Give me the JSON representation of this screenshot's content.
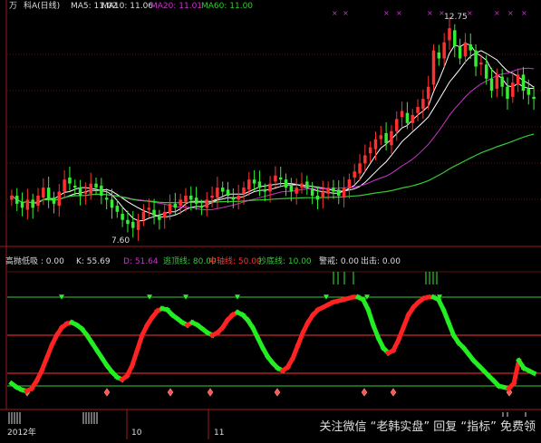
{
  "upper_header": {
    "title": "科A(日线)",
    "title_prefix": "万",
    "ma5": "MA5: 11.02",
    "ma10": "MA10: 11.06",
    "ma20": "MA20: 11.01",
    "ma60": "MA60: 11.00",
    "colors": {
      "ma5": "#ffffff",
      "ma10": "#ffffff",
      "ma20": "#cc33cc",
      "ma60": "#33cc33"
    }
  },
  "upper_annotations": {
    "high": "12.75",
    "low": "7.60"
  },
  "lower_header": {
    "name": "高抛低吸 : 0.00",
    "k": "K: 55.69",
    "d": "D: 51.64",
    "escape_top": "逃顶线: 80.00",
    "mid_axis": "中轴线: 50.00",
    "bottom_buy": "抄底线: 10.00",
    "alert": "警戒: 0.00",
    "strike": "出击: 0.00",
    "colors": {
      "name": "#dddddd",
      "k": "#dddddd",
      "d": "#cc33cc",
      "escape_top": "#33cc33",
      "mid_axis": "#ff3333",
      "bottom_buy": "#33cc33",
      "alert": "#dddddd",
      "strike": "#dddddd"
    }
  },
  "timeline": {
    "year_label": "2012年",
    "months": [
      "10",
      "11"
    ]
  },
  "watermark": "关注微信 “老韩实盘” 回复 “指标” 免费领",
  "chart_data": [
    {
      "type": "candlestick",
      "title": "科A(日线)",
      "annotations": [
        {
          "label": "12.75",
          "kind": "high"
        },
        {
          "label": "7.60",
          "kind": "low"
        }
      ],
      "close": [
        8.6,
        8.4,
        8.3,
        8.5,
        8.3,
        8.6,
        8.8,
        8.5,
        8.4,
        8.7,
        9.0,
        8.9,
        8.8,
        8.6,
        8.7,
        8.9,
        8.8,
        8.6,
        8.5,
        8.3,
        8.2,
        8.0,
        7.9,
        7.8,
        8.0,
        8.2,
        8.3,
        8.1,
        8.0,
        8.2,
        8.4,
        8.3,
        8.5,
        8.6,
        8.5,
        8.4,
        8.3,
        8.5,
        8.6,
        8.8,
        8.7,
        8.6,
        8.5,
        8.6,
        8.8,
        9.0,
        8.9,
        8.8,
        8.7,
        8.9,
        9.1,
        9.0,
        8.8,
        8.7,
        8.8,
        8.9,
        8.8,
        8.6,
        8.5,
        8.7,
        8.8,
        8.7,
        8.6,
        8.8,
        9.0,
        9.2,
        9.4,
        9.6,
        9.8,
        10.0,
        10.1,
        9.9,
        10.2,
        10.5,
        10.7,
        10.4,
        10.6,
        10.8,
        11.0,
        11.3,
        12.2,
        12.0,
        12.4,
        12.75,
        12.3,
        12.0,
        12.4,
        12.2,
        11.8,
        11.9,
        11.5,
        11.2,
        11.6,
        11.3,
        11.0,
        11.4,
        11.6,
        11.2,
        11.1,
        11.0
      ],
      "ma_lines": [
        "MA5",
        "MA10",
        "MA20",
        "MA60"
      ],
      "ma_colors": [
        "#ffffff",
        "#ffffff",
        "#cc33cc",
        "#33cc33"
      ]
    },
    {
      "type": "line",
      "title": "高抛低吸",
      "ylim": [
        0,
        100
      ],
      "reference_lines": [
        {
          "name": "逃顶线",
          "value": 80,
          "color": "#33cc33"
        },
        {
          "name": "中轴线",
          "value": 50,
          "color": "#ff3333"
        },
        {
          "name": "抄底线",
          "value": 10,
          "color": "#33cc33"
        }
      ],
      "k_values": [
        12,
        9,
        7,
        6,
        8,
        14,
        22,
        32,
        42,
        50,
        56,
        59,
        60,
        58,
        55,
        50,
        44,
        38,
        32,
        26,
        21,
        17,
        15,
        18,
        26,
        38,
        50,
        58,
        64,
        69,
        71,
        70,
        66,
        63,
        60,
        58,
        60,
        58,
        55,
        52,
        50,
        52,
        56,
        62,
        66,
        68,
        66,
        62,
        56,
        48,
        40,
        33,
        28,
        24,
        22,
        25,
        32,
        42,
        52,
        60,
        66,
        70,
        72,
        74,
        76,
        77,
        78,
        79,
        80,
        80,
        78,
        70,
        58,
        48,
        40,
        36,
        38,
        46,
        56,
        66,
        72,
        76,
        79,
        80,
        80,
        78,
        70,
        60,
        50,
        44,
        40,
        35,
        30,
        26,
        22,
        18,
        14,
        10,
        9,
        8,
        12,
        30,
        24,
        22,
        20
      ],
      "k_color_rising": "#ff2222",
      "k_color_falling": "#22ee22"
    }
  ]
}
